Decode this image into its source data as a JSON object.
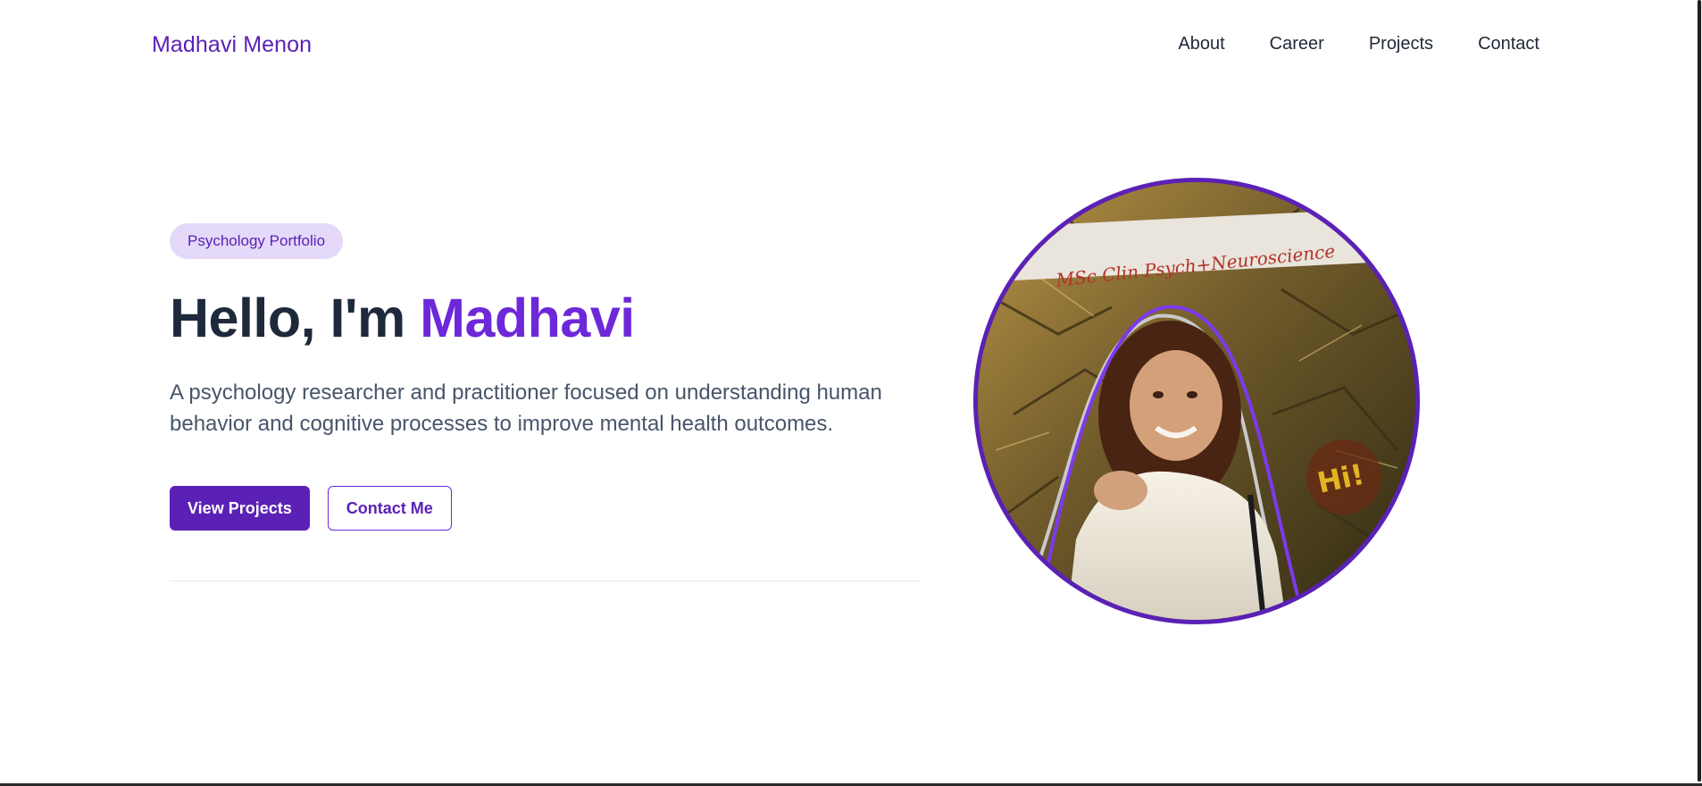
{
  "header": {
    "brand": "Madhavi Menon",
    "nav": [
      "About",
      "Career",
      "Projects",
      "Contact"
    ]
  },
  "hero": {
    "badge": "Psychology Portfolio",
    "headline_prefix": "Hello, I'm ",
    "headline_name": "Madhavi",
    "lead": "A psychology researcher and practitioner focused on understanding human behavior and cognitive processes to improve mental health outcomes.",
    "primary_button": "View Projects",
    "secondary_button": "Contact Me"
  },
  "portrait": {
    "banner_text": "MSc Clin Psych+Neuroscience",
    "sticker_text": "Hi!"
  },
  "colors": {
    "accent": "#5b21b6",
    "accent_light": "#e4d9f8",
    "heading": "#1e293b",
    "body_text": "#475569"
  }
}
